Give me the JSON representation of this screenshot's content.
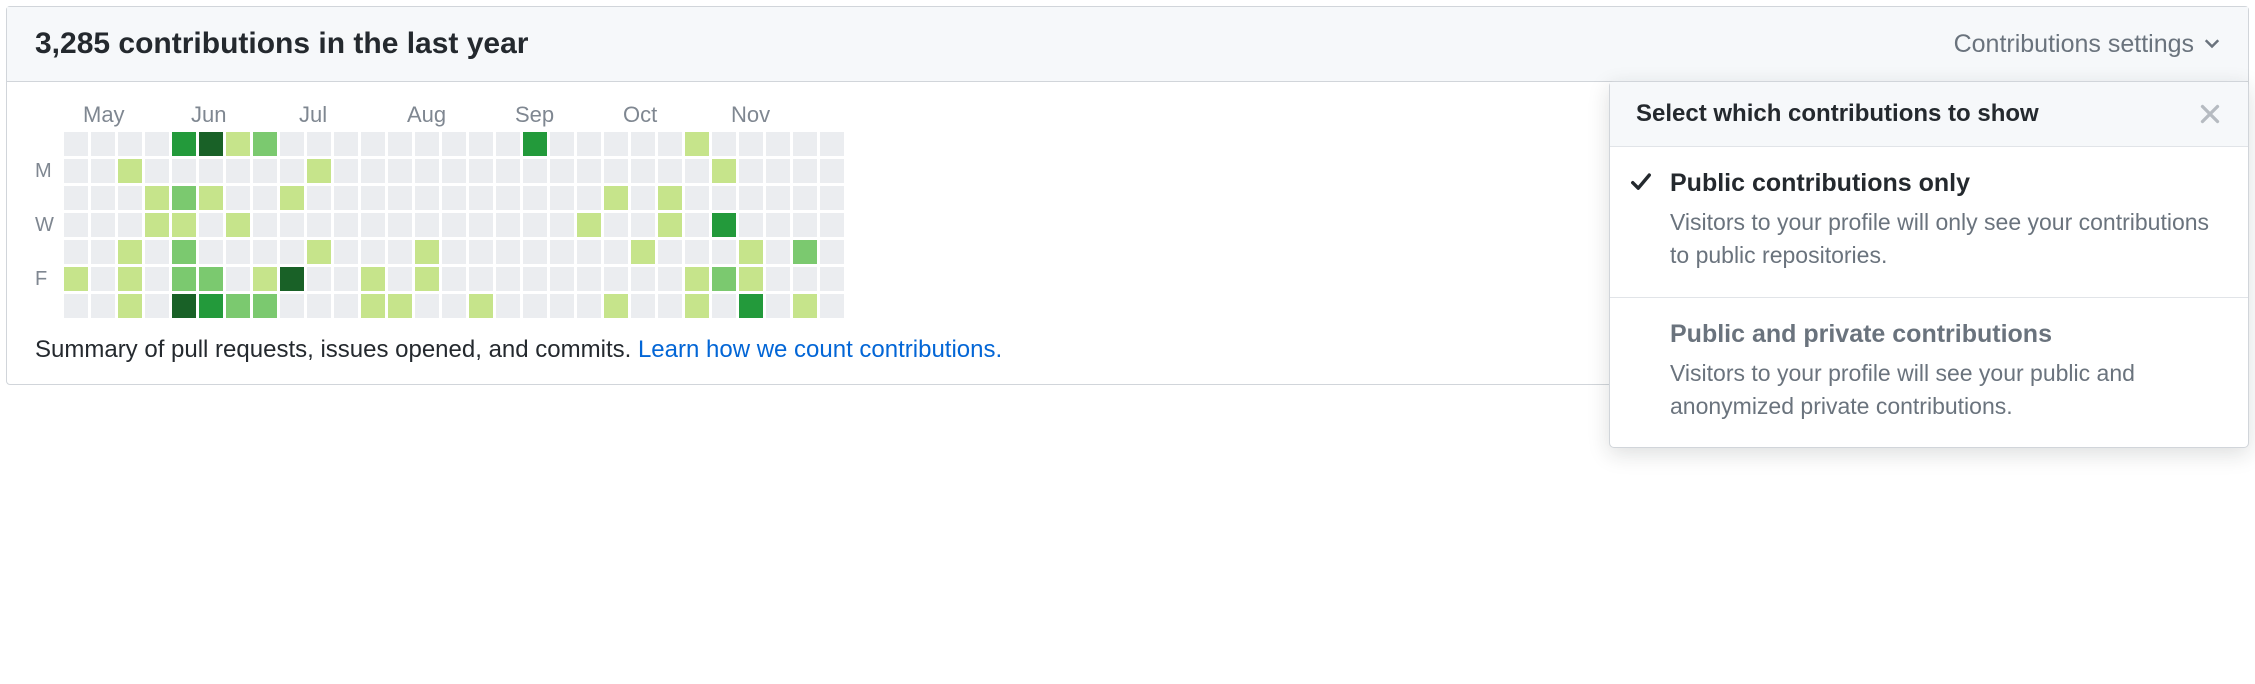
{
  "header": {
    "title": "3,285 contributions in the last year",
    "settings_label": "Contributions settings"
  },
  "calendar": {
    "months": [
      "May",
      "Jun",
      "Jul",
      "Aug",
      "Sep",
      "Oct",
      "Nov"
    ],
    "weekday_labels": [
      "",
      "M",
      "",
      "W",
      "",
      "F",
      ""
    ],
    "weeks": [
      [
        0,
        0,
        0,
        0,
        0,
        1,
        0
      ],
      [
        0,
        0,
        0,
        0,
        0,
        0,
        0
      ],
      [
        0,
        1,
        0,
        0,
        1,
        1,
        1
      ],
      [
        0,
        0,
        1,
        1,
        0,
        0,
        0
      ],
      [
        3,
        0,
        2,
        1,
        2,
        2,
        4
      ],
      [
        4,
        0,
        1,
        0,
        0,
        2,
        3
      ],
      [
        1,
        0,
        0,
        1,
        0,
        0,
        2
      ],
      [
        2,
        0,
        0,
        0,
        0,
        1,
        2
      ],
      [
        0,
        0,
        1,
        0,
        0,
        4,
        0
      ],
      [
        0,
        1,
        0,
        0,
        1,
        0,
        0
      ],
      [
        0,
        0,
        0,
        0,
        0,
        0,
        0
      ],
      [
        0,
        0,
        0,
        0,
        0,
        1,
        1
      ],
      [
        0,
        0,
        0,
        0,
        0,
        0,
        1
      ],
      [
        0,
        0,
        0,
        0,
        1,
        1,
        0
      ],
      [
        0,
        0,
        0,
        0,
        0,
        0,
        0
      ],
      [
        0,
        0,
        0,
        0,
        0,
        0,
        1
      ],
      [
        0,
        0,
        0,
        0,
        0,
        0,
        0
      ],
      [
        3,
        0,
        0,
        0,
        0,
        0,
        0
      ],
      [
        0,
        0,
        0,
        0,
        0,
        0,
        0
      ],
      [
        0,
        0,
        0,
        1,
        0,
        0,
        0
      ],
      [
        0,
        0,
        1,
        0,
        0,
        0,
        1
      ],
      [
        0,
        0,
        0,
        0,
        1,
        0,
        0
      ],
      [
        0,
        0,
        1,
        1,
        0,
        0,
        0
      ],
      [
        1,
        0,
        0,
        0,
        0,
        1,
        1
      ],
      [
        0,
        1,
        0,
        3,
        0,
        2,
        0
      ],
      [
        0,
        0,
        0,
        0,
        1,
        1,
        3
      ],
      [
        0,
        0,
        0,
        0,
        0,
        0,
        0
      ],
      [
        0,
        0,
        0,
        0,
        2,
        0,
        1
      ],
      [
        0,
        0,
        0,
        0,
        0,
        0,
        0
      ]
    ]
  },
  "summary": {
    "text": "Summary of pull requests, issues opened, and commits. ",
    "link_text": "Learn how we count contributions."
  },
  "dropdown": {
    "title": "Select which contributions to show",
    "options": [
      {
        "title": "Public contributions only",
        "desc": "Visitors to your profile will only see your contributions to public repositories.",
        "selected": true
      },
      {
        "title": "Public and private contributions",
        "desc": "Visitors to your profile will see your public and anonymized private contributions.",
        "selected": false
      }
    ]
  }
}
